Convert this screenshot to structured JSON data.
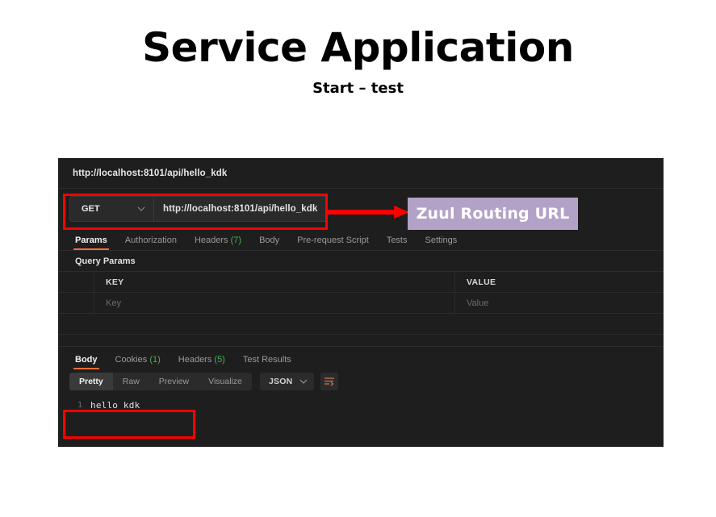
{
  "slide": {
    "title": "Service Application",
    "subtitle": "Start – test"
  },
  "postman": {
    "request_tab": {
      "label": "http://localhost:8101/api/hello_kdk"
    },
    "url_bar": {
      "method": "GET",
      "method_chevron": "chevron-down-icon",
      "url": "http://localhost:8101/api/hello_kdk"
    },
    "request_tabs": [
      {
        "label": "Params",
        "count": "",
        "active": true
      },
      {
        "label": "Authorization",
        "count": "",
        "active": false
      },
      {
        "label": "Headers",
        "count": "(7)",
        "active": false
      },
      {
        "label": "Body",
        "count": "",
        "active": false
      },
      {
        "label": "Pre-request Script",
        "count": "",
        "active": false
      },
      {
        "label": "Tests",
        "count": "",
        "active": false
      },
      {
        "label": "Settings",
        "count": "",
        "active": false
      }
    ],
    "query_params": {
      "section_label": "Query Params",
      "headers": {
        "key": "KEY",
        "value": "VALUE"
      },
      "rows": [
        {
          "key_placeholder": "Key",
          "value_placeholder": "Value"
        }
      ]
    },
    "response_tabs": [
      {
        "label": "Body",
        "count": "",
        "active": true
      },
      {
        "label": "Cookies",
        "count": "(1)",
        "active": false
      },
      {
        "label": "Headers",
        "count": "(5)",
        "active": false
      },
      {
        "label": "Test Results",
        "count": "",
        "active": false
      }
    ],
    "view_toolbar": {
      "modes": [
        {
          "label": "Pretty",
          "active": true
        },
        {
          "label": "Raw",
          "active": false
        },
        {
          "label": "Preview",
          "active": false
        },
        {
          "label": "Visualize",
          "active": false
        }
      ],
      "format": "JSON",
      "format_chevron": "chevron-down-icon",
      "wrap_icon": "word-wrap-icon"
    },
    "response_body": {
      "lines": [
        {
          "number": "1",
          "text": "hello_kdk"
        }
      ]
    }
  },
  "annotations": {
    "callout_label": "Zuul Routing URL",
    "callout_bg": "#b3a2c7",
    "highlight_color": "#ff0000",
    "accent_color": "#ff6c37"
  }
}
